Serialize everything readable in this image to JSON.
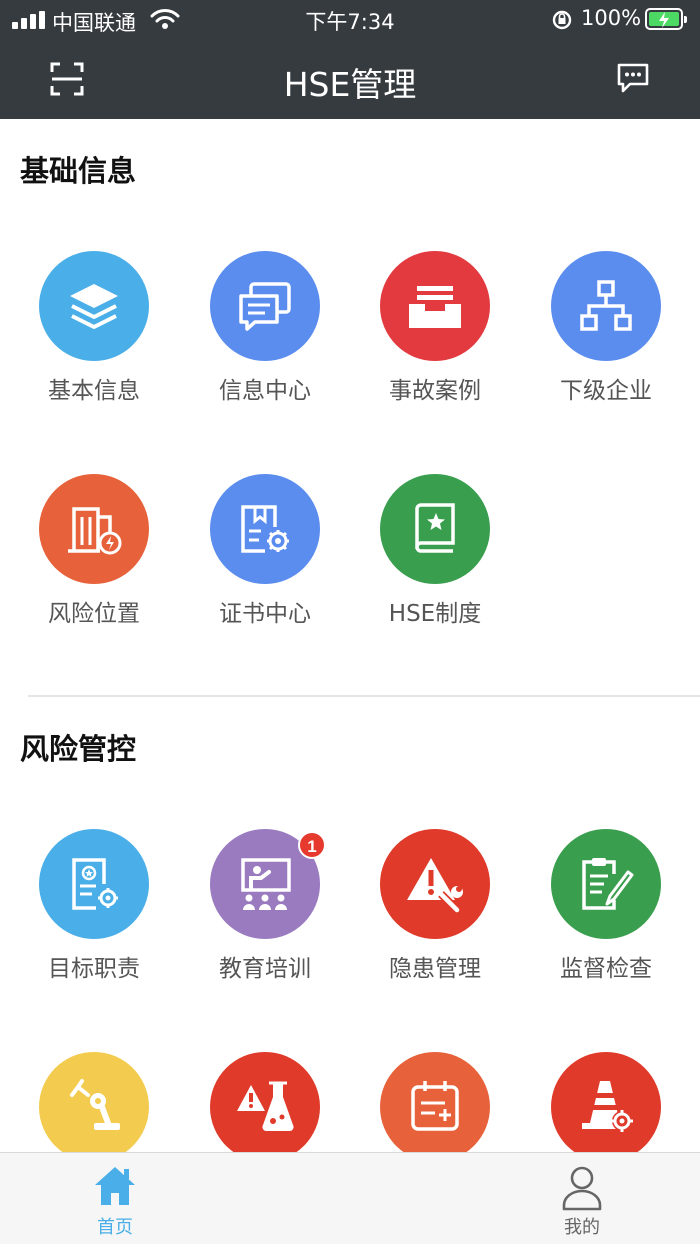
{
  "status_bar": {
    "carrier": "中国联通",
    "time": "下午7:34",
    "battery": "100%"
  },
  "nav": {
    "title": "HSE管理",
    "scan_icon": "scan-icon",
    "message_icon": "message-icon"
  },
  "sections": [
    {
      "title": "基础信息",
      "items": [
        {
          "label": "基本信息",
          "icon": "layers-icon",
          "color": "#4aaee8"
        },
        {
          "label": "信息中心",
          "icon": "chat-icon",
          "color": "#5b8def"
        },
        {
          "label": "事故案例",
          "icon": "inbox-icon",
          "color": "#e23a3f"
        },
        {
          "label": "下级企业",
          "icon": "org-chart-icon",
          "color": "#5b8def"
        },
        {
          "label": "风险位置",
          "icon": "building-icon",
          "color": "#e7623a"
        },
        {
          "label": "证书中心",
          "icon": "certificate-icon",
          "color": "#5b8def"
        },
        {
          "label": "HSE制度",
          "icon": "book-icon",
          "color": "#3a9e4f"
        }
      ]
    },
    {
      "title": "风险管控",
      "items": [
        {
          "label": "目标职责",
          "icon": "target-doc-icon",
          "color": "#4aaee8"
        },
        {
          "label": "教育培训",
          "icon": "training-icon",
          "color": "#9a7bc0",
          "badge": "1"
        },
        {
          "label": "隐患管理",
          "icon": "warning-wrench-icon",
          "color": "#e03a2a"
        },
        {
          "label": "监督检查",
          "icon": "clipboard-icon",
          "color": "#3a9e4f"
        },
        {
          "label": "",
          "icon": "robot-arm-icon",
          "color": "#f3cb4e"
        },
        {
          "label": "",
          "icon": "chemical-icon",
          "color": "#e03a2a"
        },
        {
          "label": "",
          "icon": "calendar-add-icon",
          "color": "#e7623a"
        },
        {
          "label": "",
          "icon": "cone-gear-icon",
          "color": "#e03a2a"
        }
      ]
    }
  ],
  "tabbar": {
    "tabs": [
      {
        "label": "首页",
        "icon": "home-icon",
        "active": true,
        "color": "#4aaee8"
      },
      {
        "label": "我的",
        "icon": "user-icon",
        "active": false,
        "color": "#666666"
      }
    ]
  }
}
